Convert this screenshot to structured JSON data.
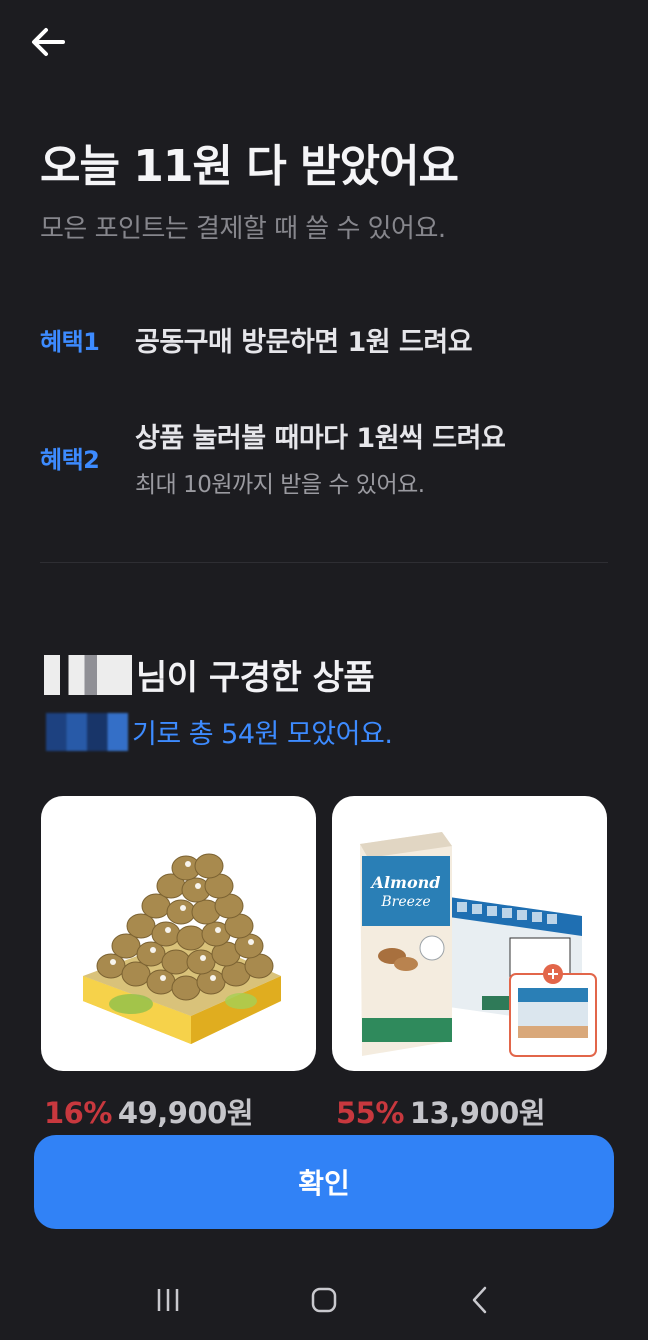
{
  "header": {
    "title": "오늘 11원 다 받았어요",
    "subtitle": "모은 포인트는 결제할 때 쓸 수 있어요."
  },
  "benefits": [
    {
      "tag": "혜택1",
      "text": "공동구매 방문하면 1원 드려요",
      "sub": ""
    },
    {
      "tag": "혜택2",
      "text": "상품 눌러볼 때마다 1원씩 드려요",
      "sub": "최대 10원까지 받을 수 있어요."
    }
  ],
  "viewed": {
    "title_suffix": "님이 구경한 상품",
    "subtitle_suffix": "기로 총 54원 모았어요."
  },
  "products": [
    {
      "image": "kiwi-box-image",
      "discount": "16%",
      "price": "49,900원"
    },
    {
      "image": "almond-breeze-image",
      "discount": "55%",
      "price": "13,900원"
    }
  ],
  "confirm_label": "확인",
  "colors": {
    "accent": "#3182f6",
    "tag_blue": "#3d8bff",
    "discount_red": "#c8383e",
    "background": "#1c1c20"
  }
}
